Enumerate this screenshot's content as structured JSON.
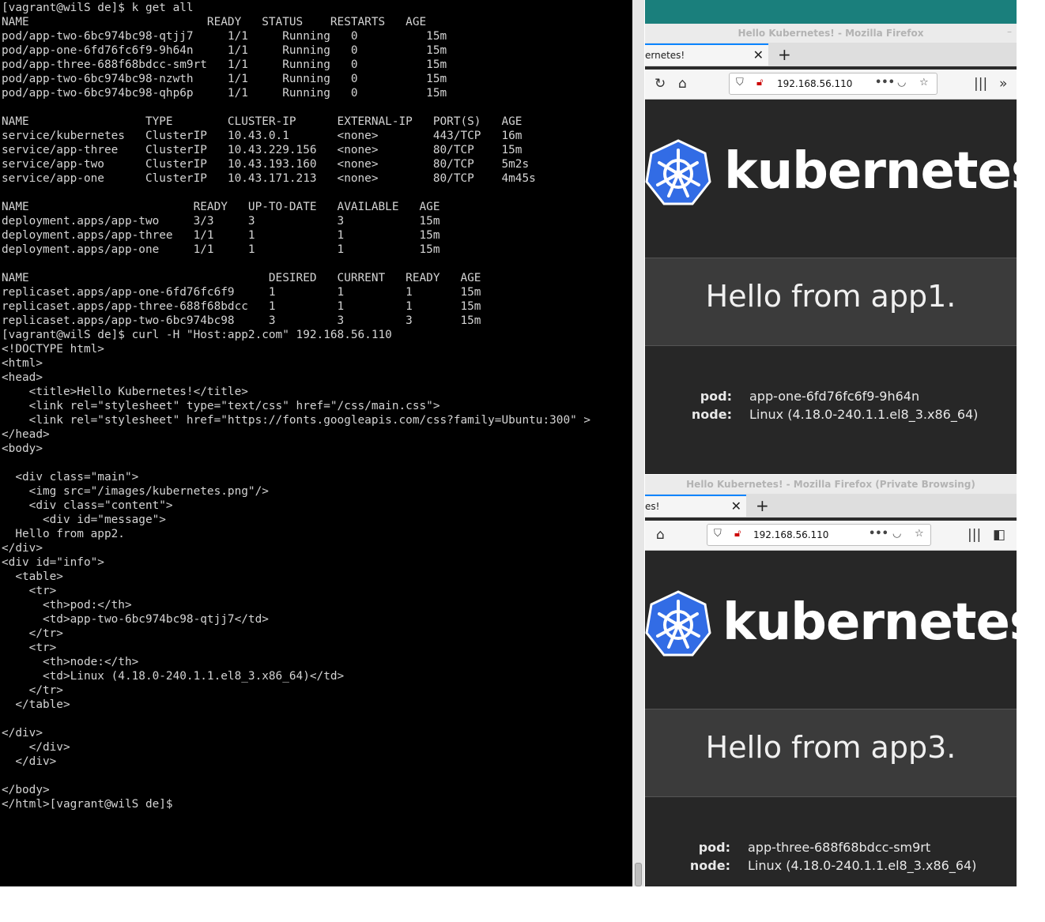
{
  "terminal": {
    "text": "[vagrant@wilS de]$ k get all\nNAME                          READY   STATUS    RESTARTS   AGE\npod/app-two-6bc974bc98-qtjj7     1/1     Running   0          15m\npod/app-one-6fd76fc6f9-9h64n     1/1     Running   0          15m\npod/app-three-688f68bdcc-sm9rt   1/1     Running   0          15m\npod/app-two-6bc974bc98-nzwth     1/1     Running   0          15m\npod/app-two-6bc974bc98-qhp6p     1/1     Running   0          15m\n\nNAME                 TYPE        CLUSTER-IP      EXTERNAL-IP   PORT(S)   AGE\nservice/kubernetes   ClusterIP   10.43.0.1       <none>        443/TCP   16m\nservice/app-three    ClusterIP   10.43.229.156   <none>        80/TCP    15m\nservice/app-two      ClusterIP   10.43.193.160   <none>        80/TCP    5m2s\nservice/app-one      ClusterIP   10.43.171.213   <none>        80/TCP    4m45s\n\nNAME                        READY   UP-TO-DATE   AVAILABLE   AGE\ndeployment.apps/app-two     3/3     3            3           15m\ndeployment.apps/app-three   1/1     1            1           15m\ndeployment.apps/app-one     1/1     1            1           15m\n\nNAME                                   DESIRED   CURRENT   READY   AGE\nreplicaset.apps/app-one-6fd76fc6f9     1         1         1       15m\nreplicaset.apps/app-three-688f68bdcc   1         1         1       15m\nreplicaset.apps/app-two-6bc974bc98     3         3         3       15m\n[vagrant@wilS de]$ curl -H \"Host:app2.com\" 192.168.56.110\n<!DOCTYPE html>\n<html>\n<head>\n    <title>Hello Kubernetes!</title>\n    <link rel=\"stylesheet\" type=\"text/css\" href=\"/css/main.css\">\n    <link rel=\"stylesheet\" href=\"https://fonts.googleapis.com/css?family=Ubuntu:300\" >\n</head>\n<body>\n\n  <div class=\"main\">\n    <img src=\"/images/kubernetes.png\"/>\n    <div class=\"content\">\n      <div id=\"message\">\n  Hello from app2.\n</div>\n<div id=\"info\">\n  <table>\n    <tr>\n      <th>pod:</th>\n      <td>app-two-6bc974bc98-qtjj7</td>\n    </tr>\n    <tr>\n      <th>node:</th>\n      <td>Linux (4.18.0-240.1.1.el8_3.x86_64)</td>\n    </tr>\n  </table>\n\n</div>\n    </div>\n  </div>\n\n</body>\n</html>[vagrant@wilS de]$"
  },
  "browser1": {
    "window_title": "Hello Kubernetes! - Mozilla Firefox",
    "tab_label": "ernetes!",
    "url": "192.168.56.110",
    "logo_text": "kubernetes",
    "message": "Hello from app1.",
    "pod_label": "pod:",
    "pod_value": "app-one-6fd76fc6f9-9h64n",
    "node_label": "node:",
    "node_value": "Linux (4.18.0-240.1.1.el8_3.x86_64)"
  },
  "browser2": {
    "window_title": "Hello Kubernetes! - Mozilla Firefox (Private Browsing)",
    "tab_label": "es!",
    "url": "192.168.56.110",
    "logo_text": "kubernetes",
    "message": "Hello from app3.",
    "pod_label": "pod:",
    "pod_value": "app-three-688f68bdcc-sm9rt",
    "node_label": "node:",
    "node_value": "Linux (4.18.0-240.1.1.el8_3.x86_64)"
  },
  "icons": {
    "close": "close-icon",
    "new_tab": "plus-icon",
    "reload": "reload-icon",
    "home": "home-icon",
    "shield": "tracking-shield-icon",
    "insecure": "insecure-lock-icon",
    "more": "more-icon",
    "pocket": "pocket-icon",
    "bookmark": "star-icon",
    "library": "library-icon",
    "overflow": "chevron-double-right-icon",
    "sidebar": "sidebar-icon"
  },
  "colors": {
    "terminal_bg": "#000000",
    "page_bg": "#272727",
    "k8s_blue": "#326ce5",
    "accent_tab": "#0a84ff"
  }
}
